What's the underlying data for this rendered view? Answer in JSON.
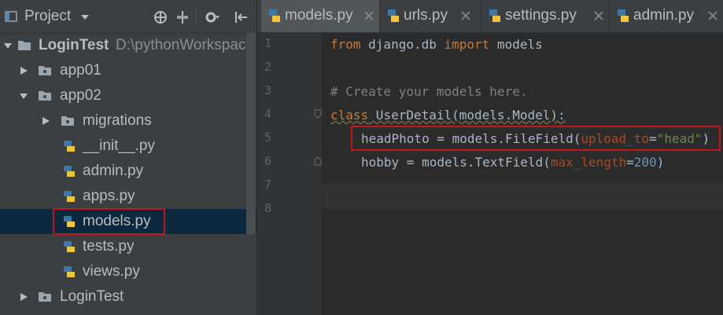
{
  "sidebar": {
    "title": "Project",
    "tree": [
      {
        "label": "LoginTest",
        "path": "D:\\pythonWorkspace",
        "bold": true
      },
      {
        "label": "app01"
      },
      {
        "label": "app02"
      },
      {
        "label": "migrations"
      },
      {
        "label": "__init__.py"
      },
      {
        "label": "admin.py"
      },
      {
        "label": "apps.py"
      },
      {
        "label": "models.py"
      },
      {
        "label": "tests.py"
      },
      {
        "label": "views.py"
      },
      {
        "label": "LoginTest"
      }
    ]
  },
  "tabs": [
    {
      "label": "models.py",
      "active": true
    },
    {
      "label": "urls.py"
    },
    {
      "label": "settings.py"
    },
    {
      "label": "admin.py"
    }
  ],
  "editor": {
    "line_numbers": [
      "1",
      "2",
      "3",
      "4",
      "5",
      "6",
      "7",
      "8"
    ],
    "code": {
      "l1_kw1": "from",
      "l1_mod": " django.db ",
      "l1_kw2": "import",
      "l1_rest": " models",
      "l3_comment": "# Create your models here.",
      "l4_kw": "class",
      "l4_rest": " UserDetail(models.Model):",
      "l5_a": "headPhoto = models.FileField(",
      "l5_param": "upload_to",
      "l5_eq": "=",
      "l5_str": "\"head\"",
      "l5_close": ")",
      "l6_a": "hobby = models.TextField(",
      "l6_param": "max_length",
      "l6_eq": "=",
      "l6_num": "200",
      "l6_close": ")"
    }
  },
  "colors": {
    "keyword": "#cc7832",
    "comment": "#808080",
    "param": "#aa4926",
    "string": "#6a8759",
    "number": "#6897bb",
    "highlight_box": "#c3161c"
  }
}
